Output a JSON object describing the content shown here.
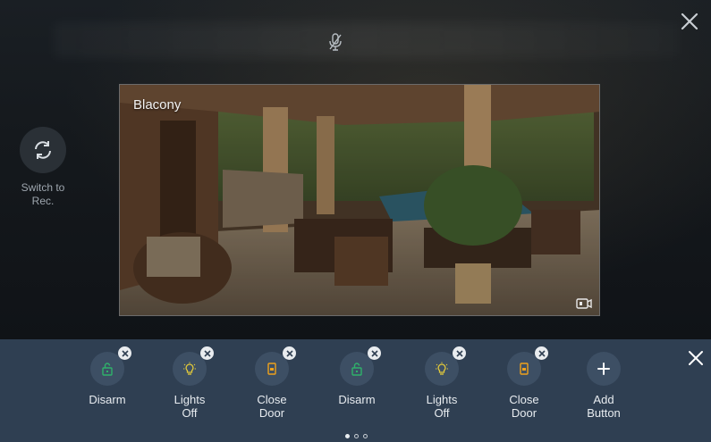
{
  "camera": {
    "title": "Blacony"
  },
  "sidebar": {
    "switch_label": "Switch to\nRec."
  },
  "bar": {
    "buttons": [
      {
        "label": "Disarm",
        "icon": "unlock-icon",
        "color": "#2fb26a"
      },
      {
        "label": "Lights\nOff",
        "icon": "bulb-icon",
        "color": "#e2c93a"
      },
      {
        "label": "Close\nDoor",
        "icon": "door-icon",
        "color": "#f0a21b"
      },
      {
        "label": "Disarm",
        "icon": "unlock-icon",
        "color": "#2fb26a"
      },
      {
        "label": "Lights\nOff",
        "icon": "bulb-icon",
        "color": "#e2c93a"
      },
      {
        "label": "Close\nDoor",
        "icon": "door-icon",
        "color": "#f0a21b"
      },
      {
        "label": "Add\nButton",
        "icon": "plus-icon",
        "color": "#ffffff"
      }
    ],
    "page_indicator": {
      "pages": 3,
      "current": 1
    }
  },
  "colors": {
    "bar_bg": "#2f3f52",
    "button_bg": "#3d4f64"
  }
}
